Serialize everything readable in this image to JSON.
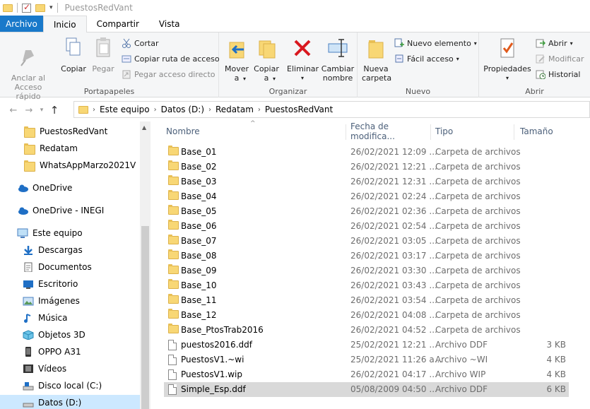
{
  "window": {
    "title": "PuestosRedVant"
  },
  "tabs": [
    {
      "label": "Archivo"
    },
    {
      "label": "Inicio"
    },
    {
      "label": "Compartir"
    },
    {
      "label": "Vista"
    }
  ],
  "ribbon": {
    "portapapeles": {
      "label": "Portapapeles",
      "pin": "Anclar al\nAcceso rápido",
      "copy": "Copiar",
      "paste": "Pegar",
      "cut": "Cortar",
      "copy_path": "Copiar ruta de acceso",
      "paste_shortcut": "Pegar acceso directo"
    },
    "organizar": {
      "label": "Organizar",
      "move": "Mover\na",
      "copy_to": "Copiar\na",
      "delete": "Eliminar",
      "rename": "Cambiar\nnombre"
    },
    "nuevo": {
      "label": "Nuevo",
      "new_folder": "Nueva\ncarpeta",
      "new_item": "Nuevo elemento",
      "easy_access": "Fácil acceso"
    },
    "abrir": {
      "label": "Abrir",
      "properties": "Propiedades",
      "open": "Abrir",
      "edit": "Modificar",
      "history": "Historial"
    }
  },
  "address": {
    "crumbs": [
      "Este equipo",
      "Datos (D:)",
      "Redatam",
      "PuestosRedVant"
    ]
  },
  "nav": {
    "items": [
      {
        "label": "PuestosRedVant",
        "icon": "folder-icon"
      },
      {
        "label": "Redatam",
        "icon": "folder-icon"
      },
      {
        "label": "WhatsAppMarzo2021V",
        "icon": "folder-icon"
      },
      {
        "label": "OneDrive",
        "icon": "cloud-icon"
      },
      {
        "label": "OneDrive - INEGI",
        "icon": "cloud-icon"
      },
      {
        "label": "Este equipo",
        "icon": "computer-icon"
      },
      {
        "label": "Descargas",
        "icon": "download-icon"
      },
      {
        "label": "Documentos",
        "icon": "documents-icon"
      },
      {
        "label": "Escritorio",
        "icon": "desktop-icon"
      },
      {
        "label": "Imágenes",
        "icon": "images-icon"
      },
      {
        "label": "Música",
        "icon": "music-icon"
      },
      {
        "label": "Objetos 3D",
        "icon": "3d-objects-icon"
      },
      {
        "label": "OPPO A31",
        "icon": "phone-icon"
      },
      {
        "label": "Vídeos",
        "icon": "videos-icon"
      },
      {
        "label": "Disco local (C:)",
        "icon": "drive-icon"
      },
      {
        "label": "Datos (D:)",
        "icon": "drive-icon"
      }
    ]
  },
  "columns": {
    "name": "Nombre",
    "date": "Fecha de modifica...",
    "type": "Tipo",
    "size": "Tamaño"
  },
  "files": [
    {
      "name": "Base_01",
      "date": "26/02/2021 12:09 ...",
      "type": "Carpeta de archivos",
      "size": "",
      "kind": "folder"
    },
    {
      "name": "Base_02",
      "date": "26/02/2021 12:21 ...",
      "type": "Carpeta de archivos",
      "size": "",
      "kind": "folder"
    },
    {
      "name": "Base_03",
      "date": "26/02/2021 12:31 ...",
      "type": "Carpeta de archivos",
      "size": "",
      "kind": "folder"
    },
    {
      "name": "Base_04",
      "date": "26/02/2021 02:24 ...",
      "type": "Carpeta de archivos",
      "size": "",
      "kind": "folder"
    },
    {
      "name": "Base_05",
      "date": "26/02/2021 02:36 ...",
      "type": "Carpeta de archivos",
      "size": "",
      "kind": "folder"
    },
    {
      "name": "Base_06",
      "date": "26/02/2021 02:54 ...",
      "type": "Carpeta de archivos",
      "size": "",
      "kind": "folder"
    },
    {
      "name": "Base_07",
      "date": "26/02/2021 03:05 ...",
      "type": "Carpeta de archivos",
      "size": "",
      "kind": "folder"
    },
    {
      "name": "Base_08",
      "date": "26/02/2021 03:17 ...",
      "type": "Carpeta de archivos",
      "size": "",
      "kind": "folder"
    },
    {
      "name": "Base_09",
      "date": "26/02/2021 03:30 ...",
      "type": "Carpeta de archivos",
      "size": "",
      "kind": "folder"
    },
    {
      "name": "Base_10",
      "date": "26/02/2021 03:43 ...",
      "type": "Carpeta de archivos",
      "size": "",
      "kind": "folder"
    },
    {
      "name": "Base_11",
      "date": "26/02/2021 03:54 ...",
      "type": "Carpeta de archivos",
      "size": "",
      "kind": "folder"
    },
    {
      "name": "Base_12",
      "date": "26/02/2021 04:08 ...",
      "type": "Carpeta de archivos",
      "size": "",
      "kind": "folder"
    },
    {
      "name": "Base_PtosTrab2016",
      "date": "26/02/2021 04:52 ...",
      "type": "Carpeta de archivos",
      "size": "",
      "kind": "folder"
    },
    {
      "name": "puestos2016.ddf",
      "date": "25/02/2021 12:21 ...",
      "type": "Archivo DDF",
      "size": "3 KB",
      "kind": "file"
    },
    {
      "name": "PuestosV1.~wi",
      "date": "25/02/2021 11:26 a...",
      "type": "Archivo ~WI",
      "size": "4 KB",
      "kind": "file"
    },
    {
      "name": "PuestosV1.wip",
      "date": "26/02/2021 04:17 ...",
      "type": "Archivo WIP",
      "size": "4 KB",
      "kind": "file"
    },
    {
      "name": "Simple_Esp.ddf",
      "date": "05/08/2009 04:50 ...",
      "type": "Archivo DDF",
      "size": "6 KB",
      "kind": "file"
    }
  ]
}
